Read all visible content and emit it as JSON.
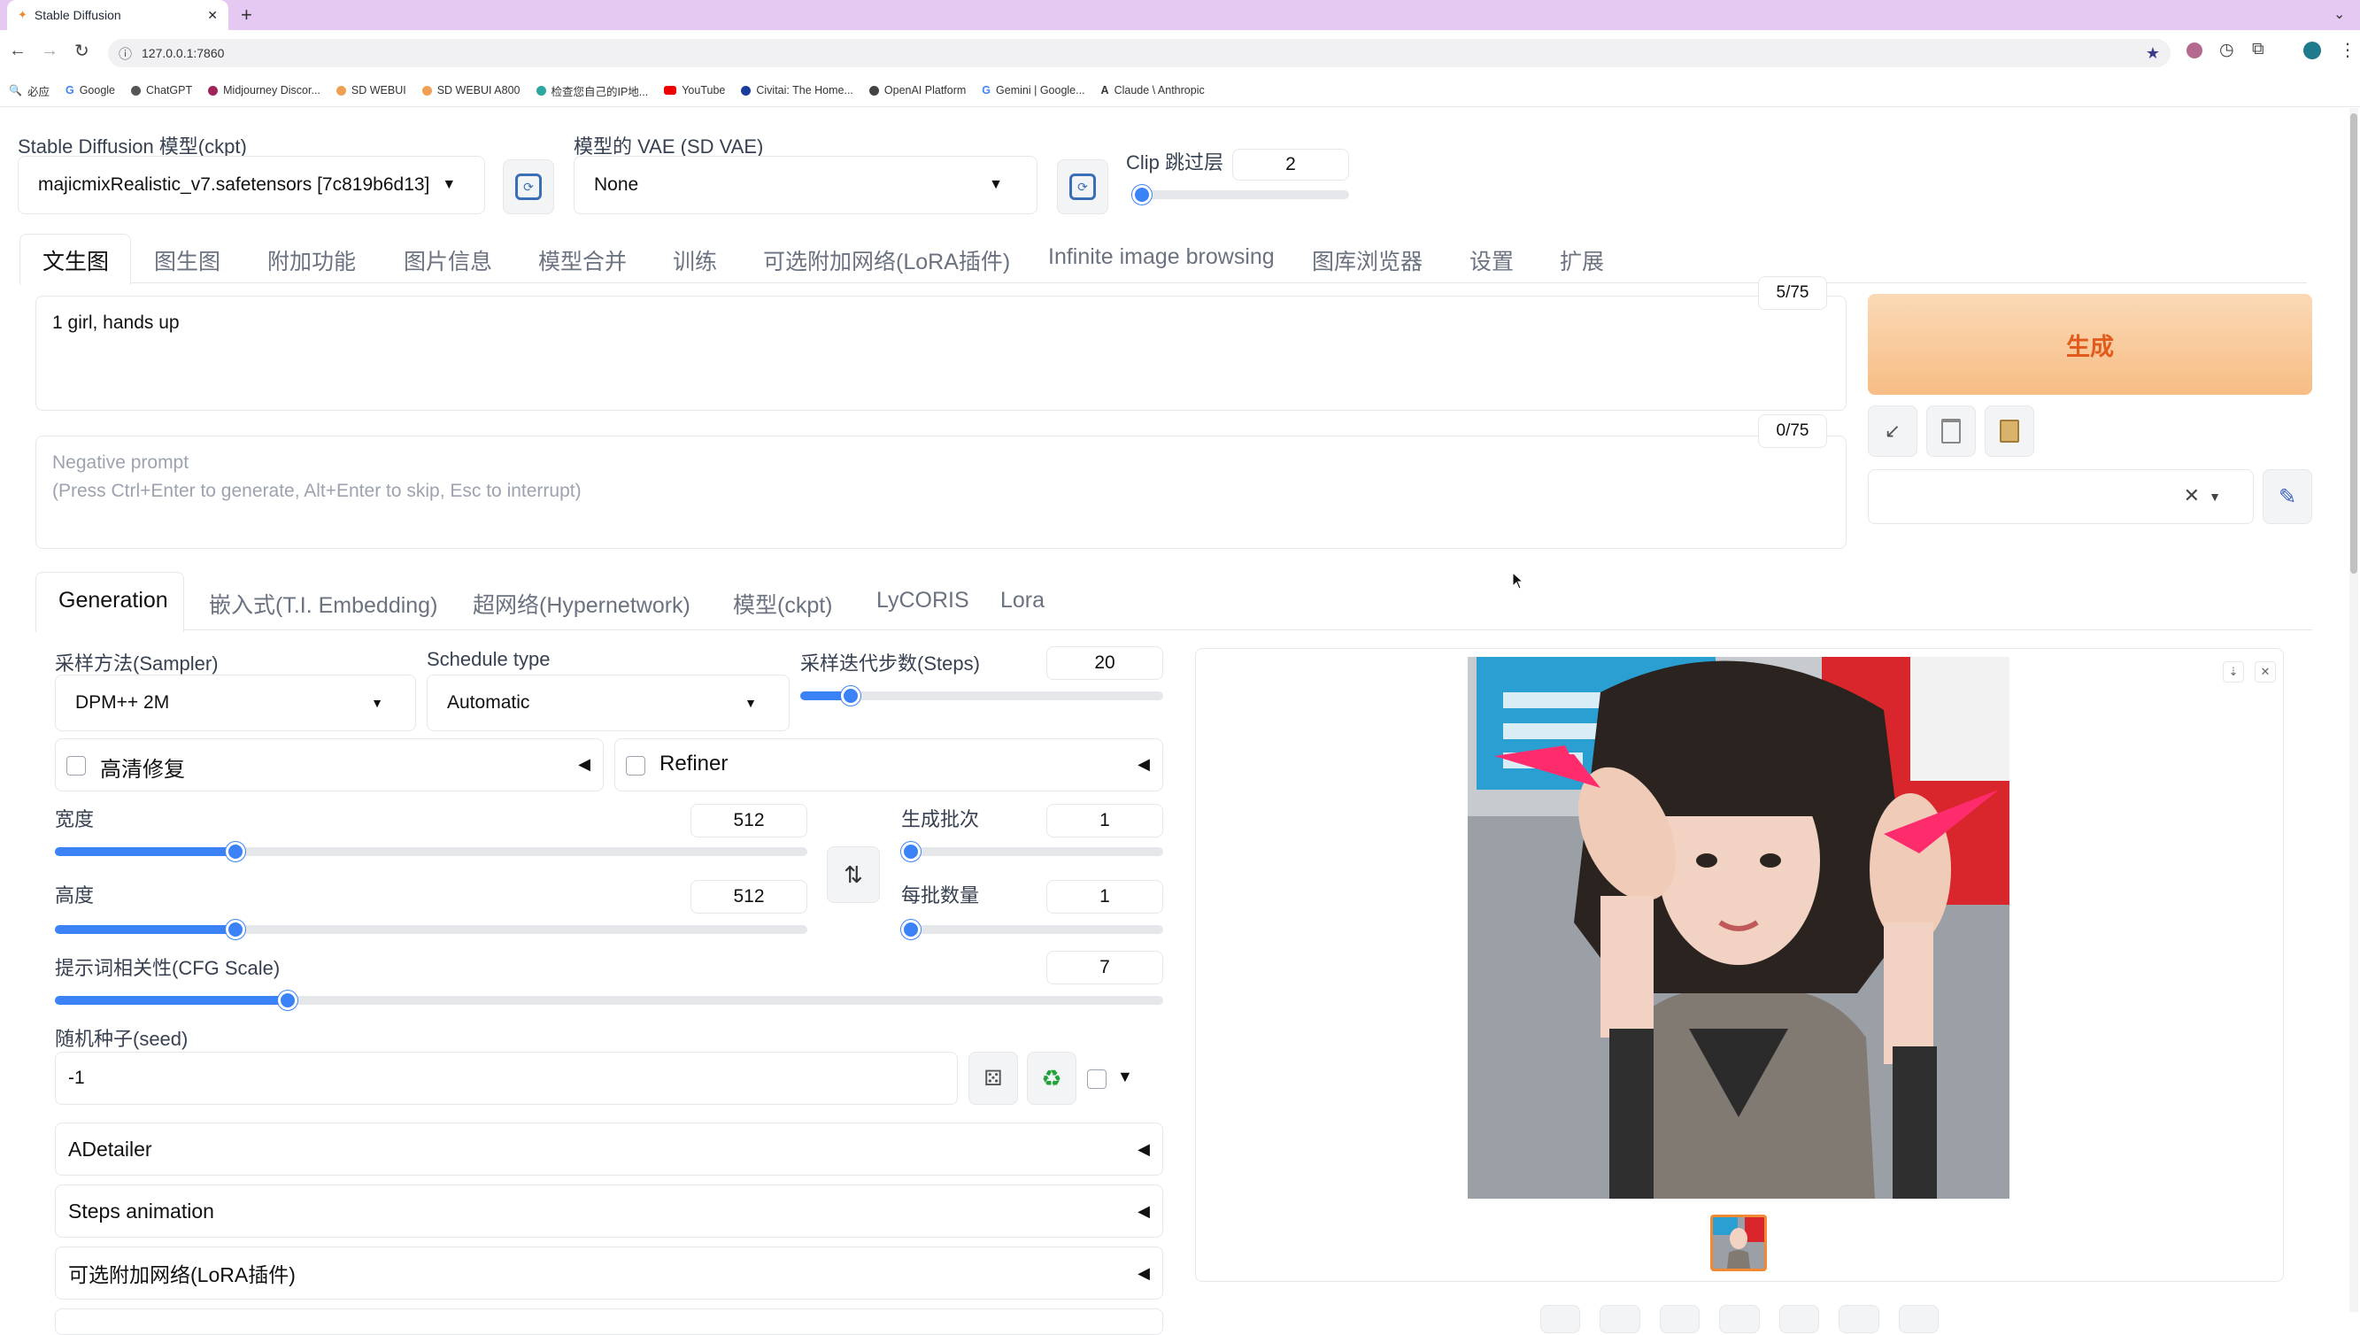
{
  "browser": {
    "tab_title": "Stable Diffusion",
    "new_tab": "+",
    "url": "127.0.0.1:7860",
    "bookmarks": [
      "必应",
      "Google",
      "ChatGPT",
      "Midjourney Discor...",
      "SD WEBUI",
      "SD WEBUI A800",
      "检查您自己的IP地...",
      "YouTube",
      "Civitai: The Home...",
      "OpenAI Platform",
      "Gemini | Google...",
      "Claude \\ Anthropic"
    ]
  },
  "top": {
    "ckpt_label": "Stable Diffusion 模型(ckpt)",
    "ckpt_value": "majicmixRealistic_v7.safetensors [7c819b6d13]",
    "vae_label": "模型的 VAE (SD VAE)",
    "vae_value": "None",
    "clip_label": "Clip 跳过层",
    "clip_value": "2",
    "clip_fraction": 0.05
  },
  "main_tabs": [
    "文生图",
    "图生图",
    "附加功能",
    "图片信息",
    "模型合并",
    "训练",
    "可选附加网络(LoRA插件)",
    "Infinite image browsing",
    "图库浏览器",
    "设置",
    "扩展"
  ],
  "prompt": {
    "text": "1 girl,  hands up",
    "counter": "5/75",
    "neg_placeholder_1": "Negative prompt",
    "neg_placeholder_2": "(Press Ctrl+Enter to generate, Alt+Enter to skip, Esc to interrupt)",
    "neg_counter": "0/75"
  },
  "generate_label": "生成",
  "sub_tabs": [
    "Generation",
    "嵌入式(T.I. Embedding)",
    "超网络(Hypernetwork)",
    "模型(ckpt)",
    "LyCORIS",
    "Lora"
  ],
  "params": {
    "sampler_label": "采样方法(Sampler)",
    "sampler_value": "DPM++ 2M",
    "schedule_label": "Schedule type",
    "schedule_value": "Automatic",
    "steps_label": "采样迭代步数(Steps)",
    "steps_value": "20",
    "steps_fraction": 0.14,
    "hires_label": "高清修复",
    "refiner_label": "Refiner",
    "width_label": "宽度",
    "width_value": "512",
    "width_fraction": 0.24,
    "height_label": "高度",
    "height_value": "512",
    "height_fraction": 0.24,
    "batch_count_label": "生成批次",
    "batch_count_value": "1",
    "batch_count_fraction": 0.0,
    "batch_size_label": "每批数量",
    "batch_size_value": "1",
    "batch_size_fraction": 0.0,
    "cfg_label": "提示词相关性(CFG Scale)",
    "cfg_value": "7",
    "cfg_fraction": 0.21,
    "seed_label": "随机种子(seed)",
    "seed_value": "-1"
  },
  "accordions": [
    "ADetailer",
    "Steps animation",
    "可选附加网络(LoRA插件)"
  ],
  "colors": {
    "accent": "#3b82f6",
    "generate_from": "#fbd7b0",
    "generate_to": "#f8c089",
    "generate_text": "#e25a1c",
    "tabstrip": "#e6c9f3"
  }
}
